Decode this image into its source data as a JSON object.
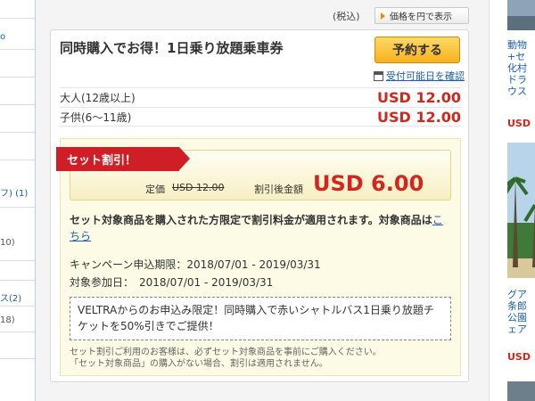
{
  "left_sidebar": {
    "labels": [
      {
        "text": "o"
      },
      {
        "text": "フ)  (1)"
      },
      {
        "text": "10)"
      },
      {
        "text": "ス(2)"
      },
      {
        "text": "18)"
      }
    ]
  },
  "header": {
    "tax_label": "(税込)",
    "currency_button": "価格を円で表示"
  },
  "card": {
    "title": "同時購入でお得！1日乗り放題乗車券",
    "reserve_button": "予約する",
    "availability_link": "受付可能日を確認",
    "prices": [
      {
        "label": "大人(12歳以上)",
        "amount": "USD 12.00"
      },
      {
        "label": "子供(6〜11歳)",
        "amount": "USD 12.00"
      }
    ]
  },
  "discount": {
    "ribbon": "セット割引！",
    "regular_label": "定価",
    "regular_price": "USD 12.00",
    "after_label": "割引後金額",
    "after_price": "USD 6.00",
    "condition_text": "セット対象商品を購入された方限定で割引料金が適用されます。対象商品は",
    "condition_link": "こちら",
    "campaign_period": "キャンペーン申込期限：2018/07/01 - 2019/03/31",
    "participation_period": "対象参加日：　2018/07/01 - 2019/03/31",
    "promo_text": "VELTRAからのお申込み限定！同時購入で赤いシャトルバス1日乗り放題チケットを50%引きでご提供！",
    "note_line1": "セット割引ご利用のお客様は、必ずセット対象商品を事前にご購入ください。",
    "note_line2": "「セット対象商品」の購入がない場合、割引は適用されません。"
  },
  "right_sidebar": {
    "item1_lines": [
      "動物",
      "+セ",
      "化村",
      "ドラ",
      "ウス"
    ],
    "item1_price": "USD",
    "item2_lines": [
      "グア",
      "条郎",
      "公園",
      "ェア"
    ],
    "item2_price": "USD"
  },
  "colors": {
    "accent_red": "#d3261c",
    "link_blue": "#1a5fb4",
    "ribbon_red": "#cf1e26",
    "button_orange": "#f7b21c"
  }
}
